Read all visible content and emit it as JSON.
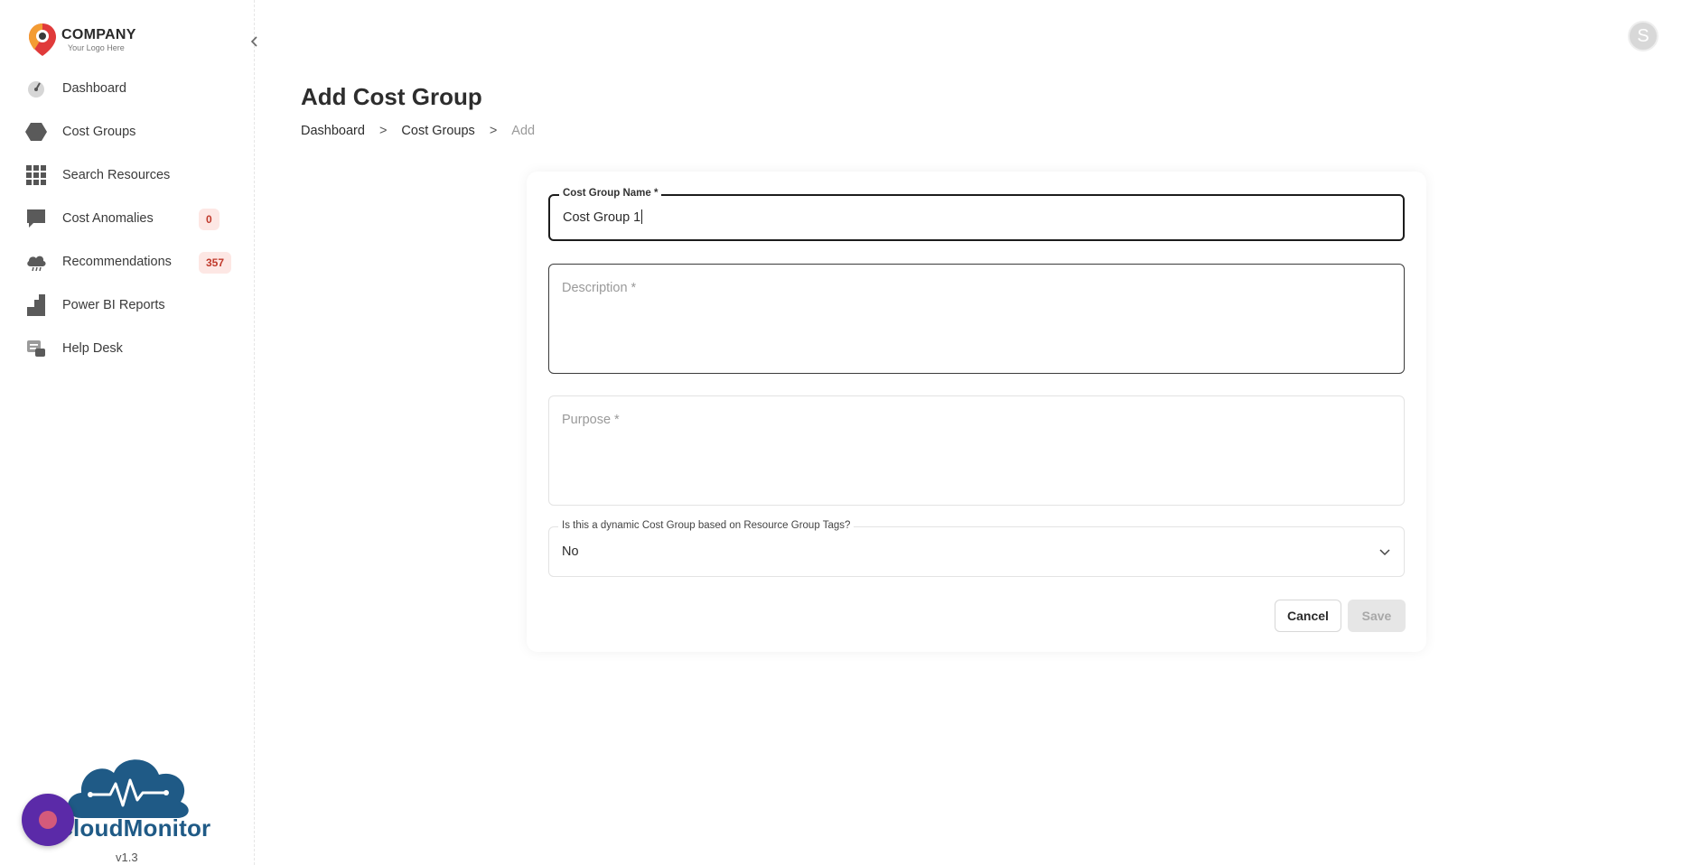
{
  "brand": {
    "company": "COMPANY",
    "tagline": "Your Logo Here",
    "product": "CloudMonitor",
    "version": "v1.3",
    "colors": {
      "pin_red": "#e03a3a",
      "pin_dark": "#3a3a3a",
      "product_blue": "#1f5a86",
      "fab_purple": "#5b2aa8"
    }
  },
  "sidebar": {
    "collapse_icon": "chevron-left-icon",
    "items": [
      {
        "label": "Dashboard",
        "icon": "gauge-icon"
      },
      {
        "label": "Cost Groups",
        "icon": "hexagon-icon"
      },
      {
        "label": "Search Resources",
        "icon": "grid-icon"
      },
      {
        "label": "Cost Anomalies",
        "icon": "chat-icon",
        "badge": "0"
      },
      {
        "label": "Recommendations",
        "icon": "cloud-icon",
        "badge": "357"
      },
      {
        "label": "Power BI Reports",
        "icon": "report-icon"
      },
      {
        "label": "Help Desk",
        "icon": "helpdesk-icon"
      }
    ]
  },
  "user": {
    "avatar_initial": "S"
  },
  "page": {
    "title": "Add Cost Group",
    "breadcrumb": {
      "items": [
        "Dashboard",
        "Cost Groups"
      ],
      "current": "Add",
      "separator": ">"
    }
  },
  "form": {
    "name": {
      "label": "Cost Group Name *",
      "value": "Cost Group 1"
    },
    "description": {
      "placeholder": "Description *"
    },
    "purpose": {
      "placeholder": "Purpose *"
    },
    "dynamic": {
      "label": "Is this a dynamic Cost Group based on Resource Group Tags?",
      "value": "No"
    },
    "cancel_label": "Cancel",
    "save_label": "Save"
  }
}
